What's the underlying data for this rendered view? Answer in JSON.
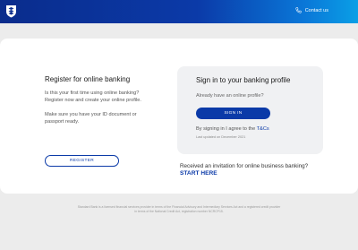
{
  "header": {
    "logo_icon": "shield-logo-icon",
    "contact_icon": "phone-icon",
    "contact_label": "Contact us"
  },
  "register": {
    "title": "Register for online banking",
    "intro": "Is this your first time using online banking? Register now and create your online profile.",
    "id_note": "Make sure you have your ID document or passport ready.",
    "button_label": "REGISTER"
  },
  "signin": {
    "title": "Sign in to your banking profile",
    "question": "Already have an online profile?",
    "button_label": "SIGN IN",
    "agree_text": "By signing in I agree to the ",
    "tcs_link": "T&Cs",
    "last_updated": "Last updated on December 2021"
  },
  "business": {
    "invite_text": "Received an invitation for online business banking?",
    "start_link": "START HERE"
  },
  "footer": {
    "line1": "Standard Bank is a licensed financial services provider in terms of the Financial Advisory and Intermediary Services Act and a registered credit provider",
    "line2": "in terms of the National Credit Act, registration number NCRCP15."
  },
  "colors": {
    "brand_blue": "#0b3aa8",
    "header_gradient_end": "#0a9fe6",
    "page_bg": "#ececec"
  }
}
